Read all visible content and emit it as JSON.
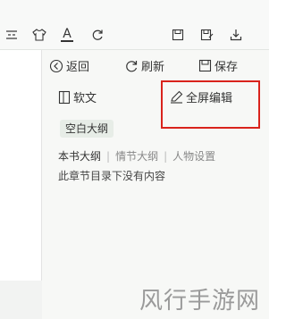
{
  "toolbar": {
    "icons": [
      "view-toggle-icon",
      "shirt-icon",
      "text-color-icon",
      "refresh-icon",
      "save-icon",
      "save-as-icon",
      "download-icon"
    ],
    "text_color_label": "A"
  },
  "panel": {
    "back_label": "返回",
    "refresh_label": "刷新",
    "save_label": "保存",
    "plain_text_label": "软文",
    "fullscreen_edit_label": "全屏编辑",
    "outline_tag": "空白大纲",
    "tabs": [
      {
        "label": "本书大纲",
        "active": true
      },
      {
        "label": "情节大纲",
        "active": false
      },
      {
        "label": "人物设置",
        "active": false
      }
    ],
    "empty_message": "此章节目录下没有内容"
  },
  "watermark": {
    "text": "风行手游网"
  },
  "colors": {
    "highlight": "#d9231c",
    "panel_bg": "#f7f8f6",
    "tag_bg": "#e7ede7"
  }
}
